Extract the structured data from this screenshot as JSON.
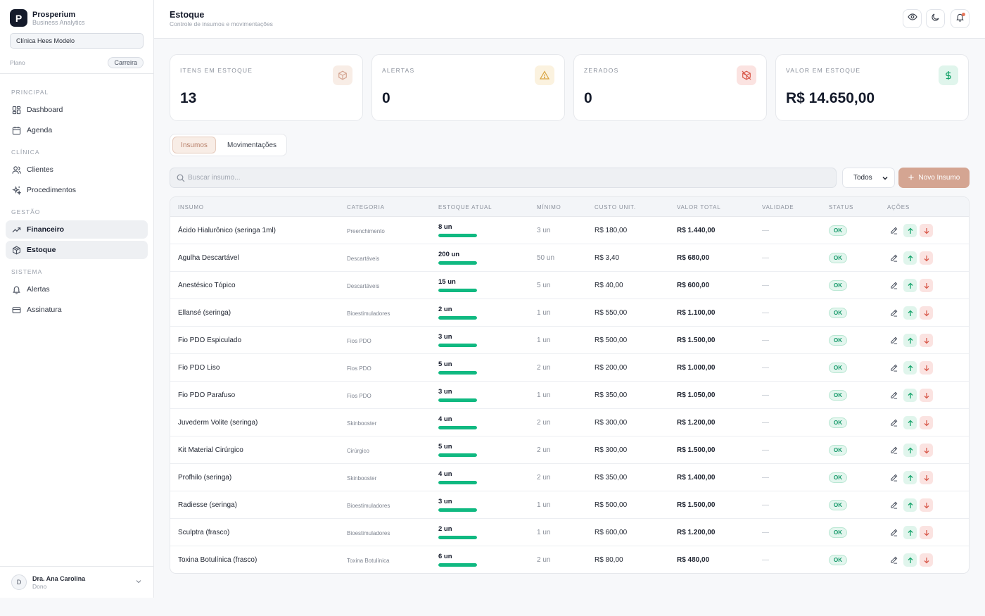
{
  "brand": {
    "logo_letter": "P",
    "name": "Prosperium",
    "subtitle": "Business Analytics"
  },
  "clinic": "Clínica Hees Modelo",
  "plan": {
    "label": "Plano",
    "value": "Carreira"
  },
  "nav": {
    "sections": [
      {
        "title": "PRINCIPAL",
        "items": [
          {
            "label": "Dashboard",
            "icon": "dashboard-icon"
          },
          {
            "label": "Agenda",
            "icon": "calendar-icon"
          }
        ]
      },
      {
        "title": "CLÍNICA",
        "items": [
          {
            "label": "Clientes",
            "icon": "users-icon"
          },
          {
            "label": "Procedimentos",
            "icon": "sparkles-icon"
          }
        ]
      },
      {
        "title": "GESTÃO",
        "items": [
          {
            "label": "Financeiro",
            "icon": "trending-up-icon"
          },
          {
            "label": "Estoque",
            "icon": "package-icon"
          }
        ]
      },
      {
        "title": "SISTEMA",
        "items": [
          {
            "label": "Alertas",
            "icon": "bell-icon"
          },
          {
            "label": "Assinatura",
            "icon": "credit-card-icon"
          }
        ]
      }
    ]
  },
  "user": {
    "initial": "D",
    "name": "Dra. Ana Carolina",
    "role": "Dono"
  },
  "header": {
    "title": "Estoque",
    "subtitle": "Controle de insumos e movimentações"
  },
  "stats": [
    {
      "label": "ITENS EM ESTOQUE",
      "value": "13",
      "icon": "box-icon",
      "icon_color": "#d4a592",
      "icon_bg": "#f8ede6"
    },
    {
      "label": "ALERTAS",
      "value": "0",
      "icon": "warning-icon",
      "icon_color": "#d9a441",
      "icon_bg": "#fbf2df"
    },
    {
      "label": "ZERADOS",
      "value": "0",
      "icon": "box-off-icon",
      "icon_color": "#d85a4c",
      "icon_bg": "#fbe3e1"
    },
    {
      "label": "VALOR EM ESTOQUE",
      "value": "R$ 14.650,00",
      "icon": "dollar-icon",
      "icon_color": "#16a36a",
      "icon_bg": "#e0f5ec"
    }
  ],
  "tabs": {
    "active": "Insumos",
    "inactive": "Movimentações"
  },
  "search": {
    "placeholder": "Buscar insumo..."
  },
  "filter": {
    "selected": "Todos"
  },
  "new_button": "Novo Insumo",
  "table": {
    "columns": [
      "INSUMO",
      "CATEGORIA",
      "ESTOQUE ATUAL",
      "MÍNIMO",
      "CUSTO UNIT.",
      "VALOR TOTAL",
      "VALIDADE",
      "STATUS",
      "AÇÕES"
    ],
    "rows": [
      {
        "name": "Ácido Hialurônico (seringa 1ml)",
        "category": "Preenchimento",
        "stock": "8 un",
        "min": "3 un",
        "unit": "R$ 180,00",
        "total": "R$ 1.440,00",
        "validity": "—",
        "status": "OK",
        "level": 1
      },
      {
        "name": "Agulha Descartável",
        "category": "Descartáveis",
        "stock": "200 un",
        "min": "50 un",
        "unit": "R$ 3,40",
        "total": "R$ 680,00",
        "validity": "—",
        "status": "OK",
        "level": 1
      },
      {
        "name": "Anestésico Tópico",
        "category": "Descartáveis",
        "stock": "15 un",
        "min": "5 un",
        "unit": "R$ 40,00",
        "total": "R$ 600,00",
        "validity": "—",
        "status": "OK",
        "level": 1
      },
      {
        "name": "Ellansé (seringa)",
        "category": "Bioestimuladores",
        "stock": "2 un",
        "min": "1 un",
        "unit": "R$ 550,00",
        "total": "R$ 1.100,00",
        "validity": "—",
        "status": "OK",
        "level": 1
      },
      {
        "name": "Fio PDO Espiculado",
        "category": "Fios PDO",
        "stock": "3 un",
        "min": "1 un",
        "unit": "R$ 500,00",
        "total": "R$ 1.500,00",
        "validity": "—",
        "status": "OK",
        "level": 1
      },
      {
        "name": "Fio PDO Liso",
        "category": "Fios PDO",
        "stock": "5 un",
        "min": "2 un",
        "unit": "R$ 200,00",
        "total": "R$ 1.000,00",
        "validity": "—",
        "status": "OK",
        "level": 1
      },
      {
        "name": "Fio PDO Parafuso",
        "category": "Fios PDO",
        "stock": "3 un",
        "min": "1 un",
        "unit": "R$ 350,00",
        "total": "R$ 1.050,00",
        "validity": "—",
        "status": "OK",
        "level": 1
      },
      {
        "name": "Juvederm Volite (seringa)",
        "category": "Skinbooster",
        "stock": "4 un",
        "min": "2 un",
        "unit": "R$ 300,00",
        "total": "R$ 1.200,00",
        "validity": "—",
        "status": "OK",
        "level": 1
      },
      {
        "name": "Kit Material Cirúrgico",
        "category": "Cirúrgico",
        "stock": "5 un",
        "min": "2 un",
        "unit": "R$ 300,00",
        "total": "R$ 1.500,00",
        "validity": "—",
        "status": "OK",
        "level": 1
      },
      {
        "name": "Profhilo (seringa)",
        "category": "Skinbooster",
        "stock": "4 un",
        "min": "2 un",
        "unit": "R$ 350,00",
        "total": "R$ 1.400,00",
        "validity": "—",
        "status": "OK",
        "level": 1
      },
      {
        "name": "Radiesse (seringa)",
        "category": "Bioestimuladores",
        "stock": "3 un",
        "min": "1 un",
        "unit": "R$ 500,00",
        "total": "R$ 1.500,00",
        "validity": "—",
        "status": "OK",
        "level": 1
      },
      {
        "name": "Sculptra (frasco)",
        "category": "Bioestimuladores",
        "stock": "2 un",
        "min": "1 un",
        "unit": "R$ 600,00",
        "total": "R$ 1.200,00",
        "validity": "—",
        "status": "OK",
        "level": 1
      },
      {
        "name": "Toxina Botulínica (frasco)",
        "category": "Toxina Botulínica",
        "stock": "6 un",
        "min": "2 un",
        "unit": "R$ 80,00",
        "total": "R$ 480,00",
        "validity": "—",
        "status": "OK",
        "level": 1
      }
    ]
  },
  "colors": {
    "accent": "#d4a592",
    "success": "#10b981",
    "danger": "#d85a4c"
  }
}
